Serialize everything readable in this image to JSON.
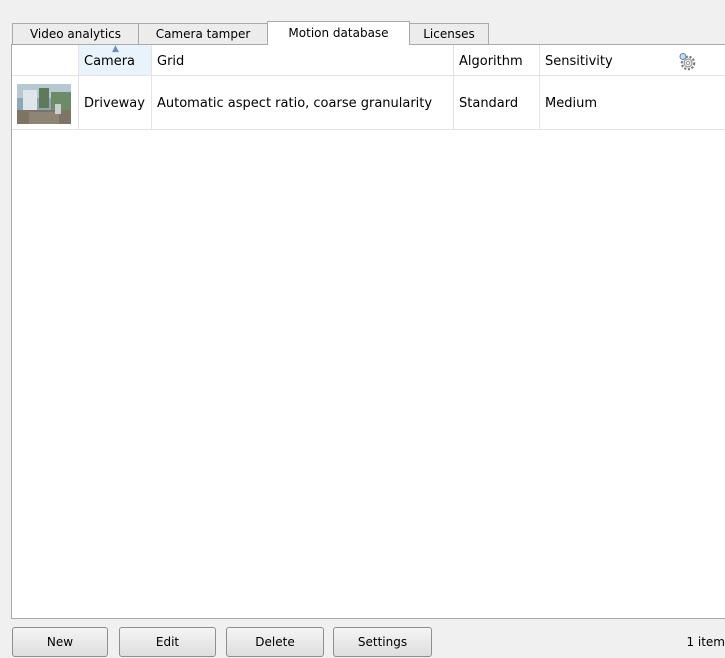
{
  "tabs": [
    {
      "label": "Video analytics",
      "active": false
    },
    {
      "label": "Camera tamper",
      "active": false
    },
    {
      "label": "Motion database",
      "active": true
    },
    {
      "label": "Licenses",
      "active": false
    }
  ],
  "grid": {
    "columns": [
      "",
      "Camera",
      "Grid",
      "Algorithm",
      "Sensitivity"
    ],
    "sorted_column": "Camera",
    "rows": [
      {
        "thumbnail": "camera-snapshot",
        "camera": "Driveway",
        "grid": "Automatic aspect ratio, coarse granularity",
        "algorithm": "Standard",
        "sensitivity": "Medium"
      }
    ]
  },
  "buttons": {
    "new": "New",
    "edit": "Edit",
    "delete": "Delete",
    "settings": "Settings"
  },
  "status": {
    "item_count": "1 item"
  },
  "icons": {
    "column_chooser": "gear-icon",
    "sort": "sort-ascending-icon"
  }
}
